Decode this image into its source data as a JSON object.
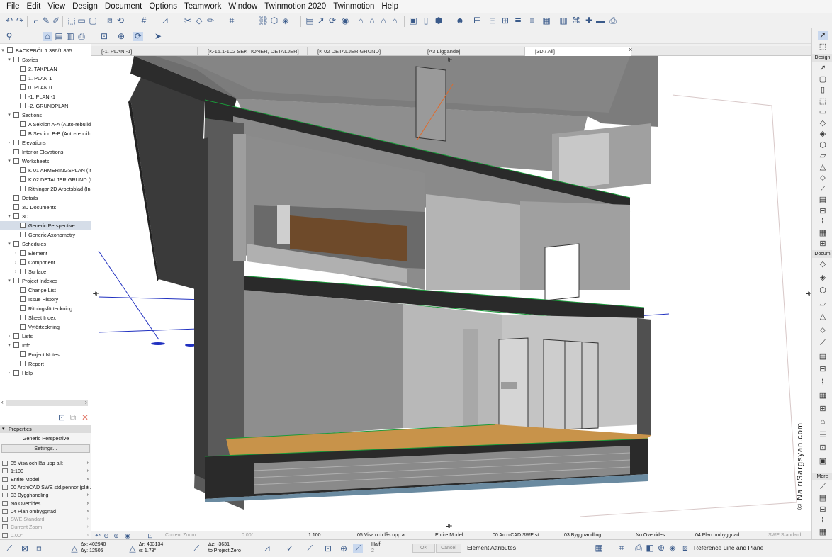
{
  "menu": [
    "File",
    "Edit",
    "View",
    "Design",
    "Document",
    "Options",
    "Teamwork",
    "Window",
    "Twinmotion 2020",
    "Twinmotion",
    "Help"
  ],
  "navigator": {
    "root": "BACKEBÖL 1:386/1:855",
    "items": [
      {
        "label": "Stories",
        "level": 1,
        "toggle": "open"
      },
      {
        "label": "2. TAKPLAN",
        "level": 2
      },
      {
        "label": "1. PLAN 1",
        "level": 2
      },
      {
        "label": "0. PLAN 0",
        "level": 2
      },
      {
        "label": "-1. PLAN -1",
        "level": 2
      },
      {
        "label": "-2. GRUNDPLAN",
        "level": 2
      },
      {
        "label": "Sections",
        "level": 1,
        "toggle": "open"
      },
      {
        "label": "A Sektion A-A (Auto-rebuild M",
        "level": 2
      },
      {
        "label": "B Sektion B-B (Auto-rebuild M",
        "level": 2
      },
      {
        "label": "Elevations",
        "level": 1,
        "toggle": "closed"
      },
      {
        "label": "Interior Elevations",
        "level": 1
      },
      {
        "label": "Worksheets",
        "level": 1,
        "toggle": "open"
      },
      {
        "label": "K 01 ARMERINGSPLAN (Indepe",
        "level": 2
      },
      {
        "label": "K 02 DETALJER GRUND (Indepe",
        "level": 2
      },
      {
        "label": "Ritningar 2D Arbetsblad (Inde",
        "level": 2
      },
      {
        "label": "Details",
        "level": 1
      },
      {
        "label": "3D Documents",
        "level": 1
      },
      {
        "label": "3D",
        "level": 1,
        "toggle": "open"
      },
      {
        "label": "Generic Perspective",
        "level": 2,
        "selected": true
      },
      {
        "label": "Generic Axonometry",
        "level": 2
      },
      {
        "label": "Schedules",
        "level": 1,
        "toggle": "open"
      },
      {
        "label": "Element",
        "level": 2,
        "toggle": "closed"
      },
      {
        "label": "Component",
        "level": 2,
        "toggle": "closed"
      },
      {
        "label": "Surface",
        "level": 2,
        "toggle": "closed"
      },
      {
        "label": "Project Indexes",
        "level": 1,
        "toggle": "open"
      },
      {
        "label": "Change List",
        "level": 2
      },
      {
        "label": "Issue History",
        "level": 2
      },
      {
        "label": "Ritningsförteckning",
        "level": 2
      },
      {
        "label": "Sheet Index",
        "level": 2
      },
      {
        "label": "Vyförteckning",
        "level": 2
      },
      {
        "label": "Lists",
        "level": 1,
        "toggle": "closed"
      },
      {
        "label": "Info",
        "level": 1,
        "toggle": "open"
      },
      {
        "label": "Project Notes",
        "level": 2
      },
      {
        "label": "Report",
        "level": 2
      },
      {
        "label": "Help",
        "level": 1,
        "toggle": "closed"
      }
    ]
  },
  "properties": {
    "header": "Properties",
    "name": "Generic Perspective",
    "settings_button": "Settings...",
    "rows": [
      {
        "label": "05 Visa och lås upp allt",
        "dim": false
      },
      {
        "label": "1:100",
        "dim": false
      },
      {
        "label": "Entire Model",
        "dim": false
      },
      {
        "label": "00 ArchiCAD SWE std.pennor (pla...",
        "dim": false
      },
      {
        "label": "03 Bygghandling",
        "dim": false
      },
      {
        "label": "No Overrides",
        "dim": false
      },
      {
        "label": "04 Plan ombyggnad",
        "dim": false
      },
      {
        "label": "SWE Standard",
        "dim": true
      },
      {
        "label": "Current Zoom",
        "dim": true
      },
      {
        "label": "0.00°",
        "dim": true
      }
    ]
  },
  "tabs": [
    {
      "label": "[-1. PLAN -1]",
      "active": false
    },
    {
      "label": "[K-15.1-102 SEKTIONER, DETALJER]",
      "active": false
    },
    {
      "label": "[K 02 DETALJER GRUND]",
      "active": false
    },
    {
      "label": "[A3 Liggande]",
      "active": false
    },
    {
      "label": "[3D / All]",
      "active": true
    }
  ],
  "toolbox": {
    "sections": [
      "Design",
      "Docum",
      "More"
    ]
  },
  "watermark": "© NairiSargsyan.com",
  "statusbar": {
    "zoom": "Current Zoom",
    "angle": "0.00°",
    "scale": "1:100",
    "layer_combo": "05 Visa och lås upp a...",
    "model": "Entire Model",
    "pen_set": "00 ArchiCAD SWE st...",
    "mvo": "03 Bygghandling",
    "overrides": "No Overrides",
    "renovation": "04 Plan ombyggnad",
    "dimension": "SWE Standard"
  },
  "infobar": {
    "dx": "Δx: 402940",
    "dy": "Δy: 12505",
    "dr": "Δr: 403134",
    "da": "α: 1.78°",
    "dz": "Δz: -3631",
    "to": "to Project Zero",
    "half": "Half",
    "half_n": "2",
    "ok": "OK",
    "cancel": "Cancel",
    "element_attributes": "Element Attributes",
    "reference": "Reference Line and Plane"
  },
  "colors": {
    "edge_green": "#1a9a3a",
    "floor_wood": "#c8934a",
    "interior": "#b8b8b8",
    "dark_slab": "#2a2a2a"
  }
}
